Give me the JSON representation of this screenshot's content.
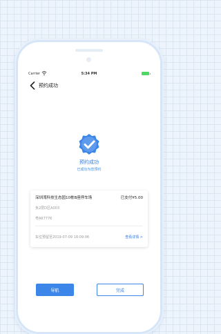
{
  "status_bar": {
    "carrier": "Carrier",
    "time": "5:34 PM"
  },
  "nav": {
    "title": "预约成功"
  },
  "success": {
    "title": "预约成功",
    "subtitle": "已成功为您预约"
  },
  "card": {
    "lot_name": "深圳湾科技生态园10栋B座停车场",
    "paid": "已支付¥5.00",
    "zone": "负2层D区A003",
    "plate": "粤A67776",
    "reserved_time": "车位预留至2019-07-09 18:09:06",
    "details_link": "查看详情 >"
  },
  "buttons": {
    "navigate": "导航",
    "done": "完成"
  },
  "colors": {
    "accent": "#3b86e8",
    "battery": "#4cd964"
  }
}
